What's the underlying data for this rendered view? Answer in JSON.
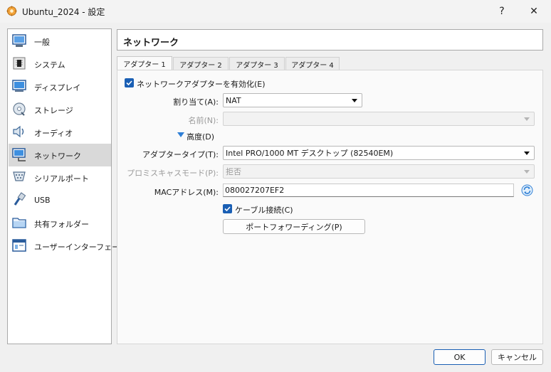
{
  "window": {
    "title": "Ubuntu_2024 - 設定",
    "help_label": "?",
    "close_label": "✕"
  },
  "sidebar": {
    "items": [
      {
        "label": "一般",
        "icon": "general-icon"
      },
      {
        "label": "システム",
        "icon": "system-chip-icon"
      },
      {
        "label": "ディスプレイ",
        "icon": "monitor-icon"
      },
      {
        "label": "ストレージ",
        "icon": "storage-disk-icon"
      },
      {
        "label": "オーディオ",
        "icon": "speaker-icon"
      },
      {
        "label": "ネットワーク",
        "icon": "network-icon"
      },
      {
        "label": "シリアルポート",
        "icon": "serial-port-icon"
      },
      {
        "label": "USB",
        "icon": "usb-icon"
      },
      {
        "label": "共有フォルダー",
        "icon": "folder-icon"
      },
      {
        "label": "ユーザーインターフェース",
        "icon": "ui-window-icon"
      }
    ],
    "selected": "ネットワーク"
  },
  "header": {
    "title": "ネットワーク"
  },
  "tabs": [
    {
      "label": "アダプター 1",
      "active": true
    },
    {
      "label": "アダプター 2",
      "active": false
    },
    {
      "label": "アダプター 3",
      "active": false
    },
    {
      "label": "アダプター 4",
      "active": false
    }
  ],
  "form": {
    "enable_adapter_label": "ネットワークアダプターを有効化(E)",
    "enable_adapter_checked": true,
    "attached_to_label": "割り当て(A):",
    "attached_to_value": "NAT",
    "name_label": "名前(N):",
    "name_value": "",
    "advanced_label": "高度(D)",
    "adapter_type_label": "アダプタータイプ(T):",
    "adapter_type_value": "Intel PRO/1000 MT デスクトップ (82540EM)",
    "promisc_label": "プロミスキャスモード(P):",
    "promisc_value": "拒否",
    "mac_label": "MACアドレス(M):",
    "mac_value": "080027207EF2",
    "cable_label": "ケーブル接続(C)",
    "cable_checked": true,
    "port_forward_label": "ポートフォワーディング(P)"
  },
  "footer": {
    "ok_label": "OK",
    "cancel_label": "キャンセル"
  },
  "colors": {
    "accent": "#1a5fb4",
    "selected_bg": "#d9d9d9"
  }
}
